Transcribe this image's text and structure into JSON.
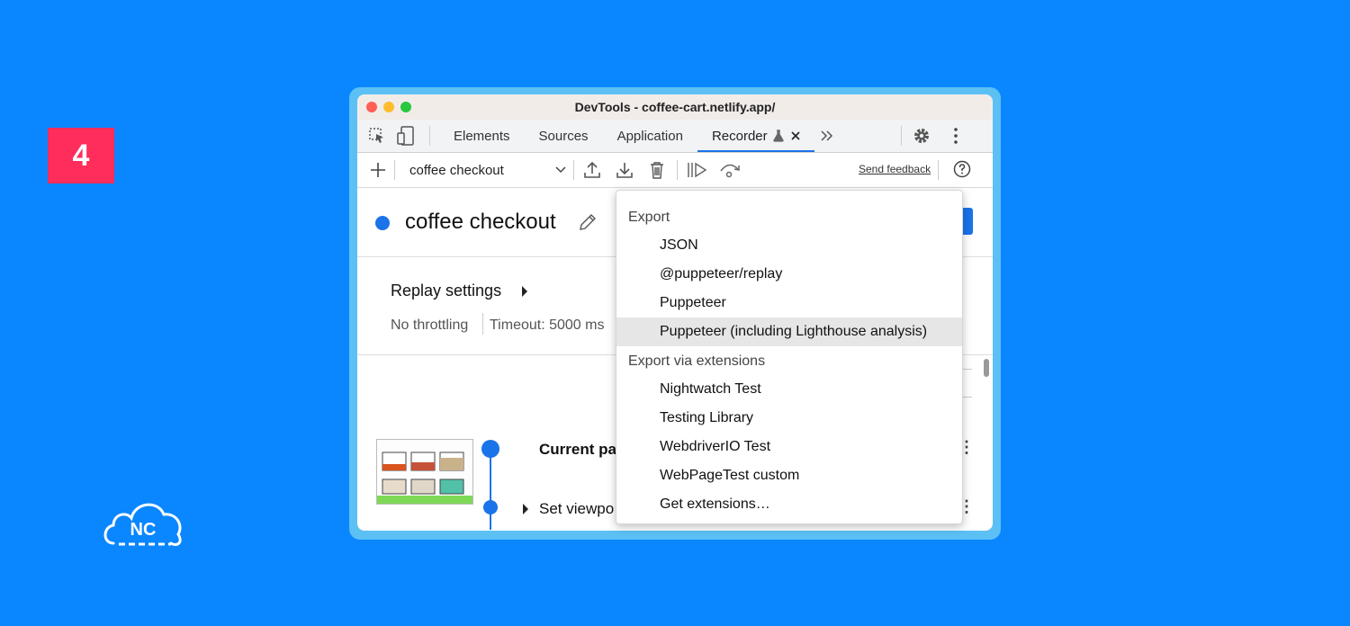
{
  "step_number": "4",
  "logo_text": "NC",
  "window": {
    "title": "DevTools - coffee-cart.netlify.app/"
  },
  "tabs": [
    {
      "label": "Elements"
    },
    {
      "label": "Sources"
    },
    {
      "label": "Application"
    },
    {
      "label": "Recorder",
      "active": true
    }
  ],
  "toolbar": {
    "recording_name": "coffee checkout",
    "send_feedback": "Send feedback"
  },
  "recording": {
    "title": "coffee checkout",
    "replay_settings": "Replay settings",
    "throttling": "No throttling",
    "timeout": "Timeout: 5000 ms",
    "steps": [
      {
        "label": "Current pa"
      },
      {
        "label": "Set viewpo"
      }
    ]
  },
  "export_menu": {
    "export_header": "Export",
    "export_items": [
      "JSON",
      "@puppeteer/replay",
      "Puppeteer",
      "Puppeteer (including Lighthouse analysis)"
    ],
    "extensions_header": "Export via extensions",
    "extension_items": [
      "Nightwatch Test",
      "Testing Library",
      "WebdriverIO Test",
      "WebPageTest custom",
      "Get extensions…"
    ],
    "highlighted_item": "Puppeteer (including Lighthouse analysis)"
  },
  "colors": {
    "background": "#0a86ff",
    "badge": "#ff2d5b",
    "accent": "#1a73e8"
  },
  "icons": [
    "inspect-icon",
    "device-toggle-icon",
    "flask-icon",
    "close-icon",
    "more-tabs-icon",
    "gear-icon",
    "kebab-icon",
    "plus-icon",
    "chevron-down-icon",
    "upload-icon",
    "download-icon",
    "trash-icon",
    "replay-icon",
    "step-over-icon",
    "help-icon",
    "pencil-icon"
  ]
}
